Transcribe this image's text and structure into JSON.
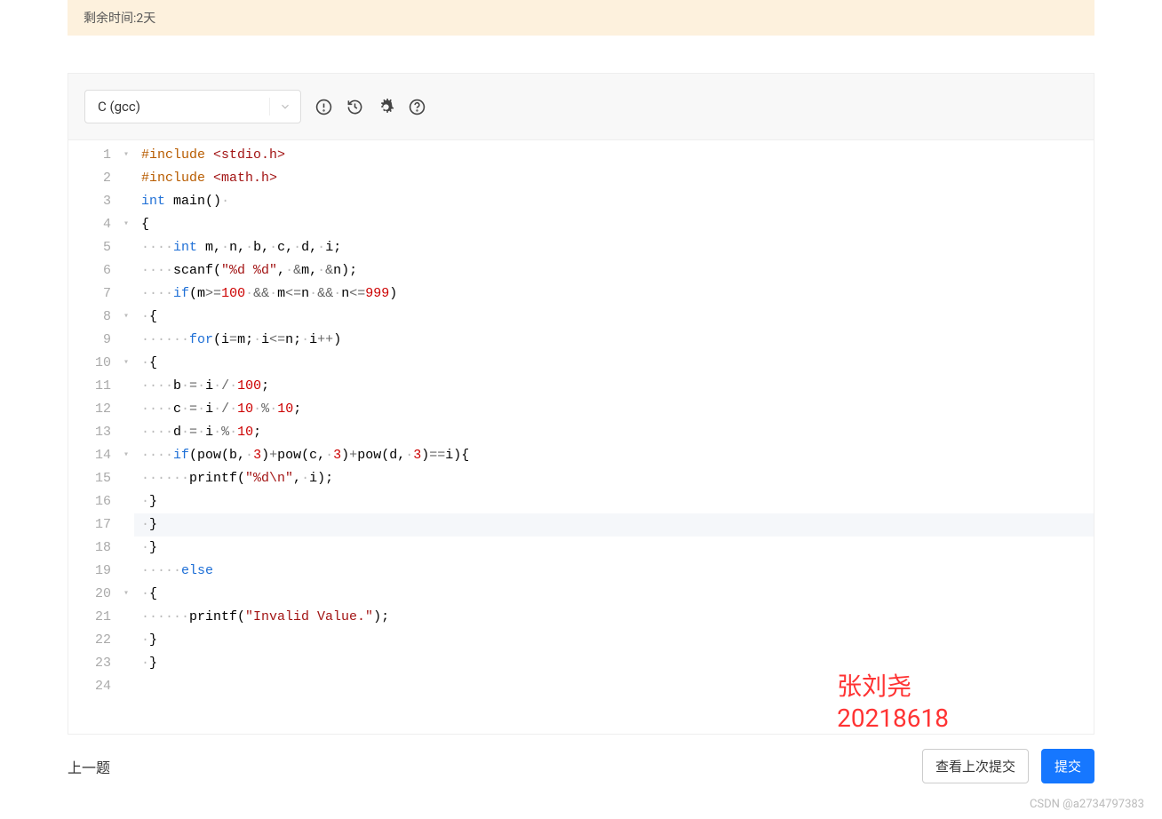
{
  "notice": {
    "text": "剩余时间:2天"
  },
  "toolbar": {
    "language": "C (gcc)"
  },
  "code_lines": [
    {
      "n": "1",
      "fold": "▾",
      "html": "<span class='mg'>#include</span> <span class='st'>&lt;stdio.h&gt;</span>"
    },
    {
      "n": "2",
      "fold": "",
      "html": "<span class='mg'>#include</span> <span class='st'>&lt;math.h&gt;</span>"
    },
    {
      "n": "3",
      "fold": "",
      "html": "<span class='ty'>int</span> <span class='fn'>main</span>()<span class='ds'>·</span>"
    },
    {
      "n": "4",
      "fold": "▾",
      "html": "{"
    },
    {
      "n": "5",
      "fold": "",
      "html": "<span class='ds'>····</span><span class='ty'>int</span> m,<span class='ds'>·</span>n,<span class='ds'>·</span>b,<span class='ds'>·</span>c,<span class='ds'>·</span>d,<span class='ds'>·</span>i;"
    },
    {
      "n": "6",
      "fold": "",
      "html": "<span class='ds'>····</span>scanf(<span class='st'>\"%d %d\"</span>,<span class='ds'>·</span><span class='op'>&amp;</span>m,<span class='ds'>·</span><span class='op'>&amp;</span>n);"
    },
    {
      "n": "7",
      "fold": "",
      "html": "<span class='ds'>····</span><span class='kw'>if</span>(m<span class='op'>&gt;=</span><span class='nm'>100</span><span class='ds'>·</span><span class='op'>&amp;&amp;</span><span class='ds'>·</span>m<span class='op'>&lt;=</span>n<span class='ds'>·</span><span class='op'>&amp;&amp;</span><span class='ds'>·</span>n<span class='op'>&lt;=</span><span class='nm'>999</span>)"
    },
    {
      "n": "8",
      "fold": "▾",
      "html": "<span class='ds'>·</span>{"
    },
    {
      "n": "9",
      "fold": "",
      "html": "<span class='ds'>······</span><span class='kw'>for</span>(i<span class='op'>=</span>m;<span class='ds'>·</span>i<span class='op'>&lt;=</span>n;<span class='ds'>·</span>i<span class='op'>++</span>)"
    },
    {
      "n": "10",
      "fold": "▾",
      "html": "<span class='ds'>·</span>{"
    },
    {
      "n": "11",
      "fold": "",
      "html": "<span class='ds'>····</span>b<span class='ds'>·</span><span class='op'>=</span><span class='ds'>·</span>i<span class='ds'>·</span><span class='op'>/</span><span class='ds'>·</span><span class='nm'>100</span>;"
    },
    {
      "n": "12",
      "fold": "",
      "html": "<span class='ds'>····</span>c<span class='ds'>·</span><span class='op'>=</span><span class='ds'>·</span>i<span class='ds'>·</span><span class='op'>/</span><span class='ds'>·</span><span class='nm'>10</span><span class='ds'>·</span><span class='op'>%</span><span class='ds'>·</span><span class='nm'>10</span>;"
    },
    {
      "n": "13",
      "fold": "",
      "html": "<span class='ds'>····</span>d<span class='ds'>·</span><span class='op'>=</span><span class='ds'>·</span>i<span class='ds'>·</span><span class='op'>%</span><span class='ds'>·</span><span class='nm'>10</span>;"
    },
    {
      "n": "14",
      "fold": "▾",
      "html": "<span class='ds'>····</span><span class='kw'>if</span>(pow(b,<span class='ds'>·</span><span class='nm'>3</span>)<span class='op'>+</span>pow(c,<span class='ds'>·</span><span class='nm'>3</span>)<span class='op'>+</span>pow(d,<span class='ds'>·</span><span class='nm'>3</span>)<span class='op'>==</span>i){"
    },
    {
      "n": "15",
      "fold": "",
      "html": "<span class='ds'>······</span>printf(<span class='st'>\"%d\\n\"</span>,<span class='ds'>·</span>i);"
    },
    {
      "n": "16",
      "fold": "",
      "html": "<span class='ds'>·</span>}"
    },
    {
      "n": "17",
      "fold": "",
      "html": "<span class='ds'>·</span>}",
      "hl": true
    },
    {
      "n": "18",
      "fold": "",
      "html": "<span class='ds'>·</span>}"
    },
    {
      "n": "19",
      "fold": "",
      "html": "<span class='ds'>·····</span><span class='kw'>else</span>"
    },
    {
      "n": "20",
      "fold": "▾",
      "html": "<span class='ds'>·</span>{"
    },
    {
      "n": "21",
      "fold": "",
      "html": "<span class='ds'>······</span>printf(<span class='st'>\"Invalid Value.\"</span>);"
    },
    {
      "n": "22",
      "fold": "",
      "html": "<span class='ds'>·</span>}"
    },
    {
      "n": "23",
      "fold": "",
      "html": "<span class='ds'>·</span>}"
    },
    {
      "n": "24",
      "fold": "",
      "html": ""
    }
  ],
  "overlay": {
    "line1": "张刘尧",
    "line2": "20218618"
  },
  "footer": {
    "prev": "上一题",
    "view_last": "查看上次提交",
    "submit": "提交"
  },
  "watermark": "CSDN @a2734797383"
}
